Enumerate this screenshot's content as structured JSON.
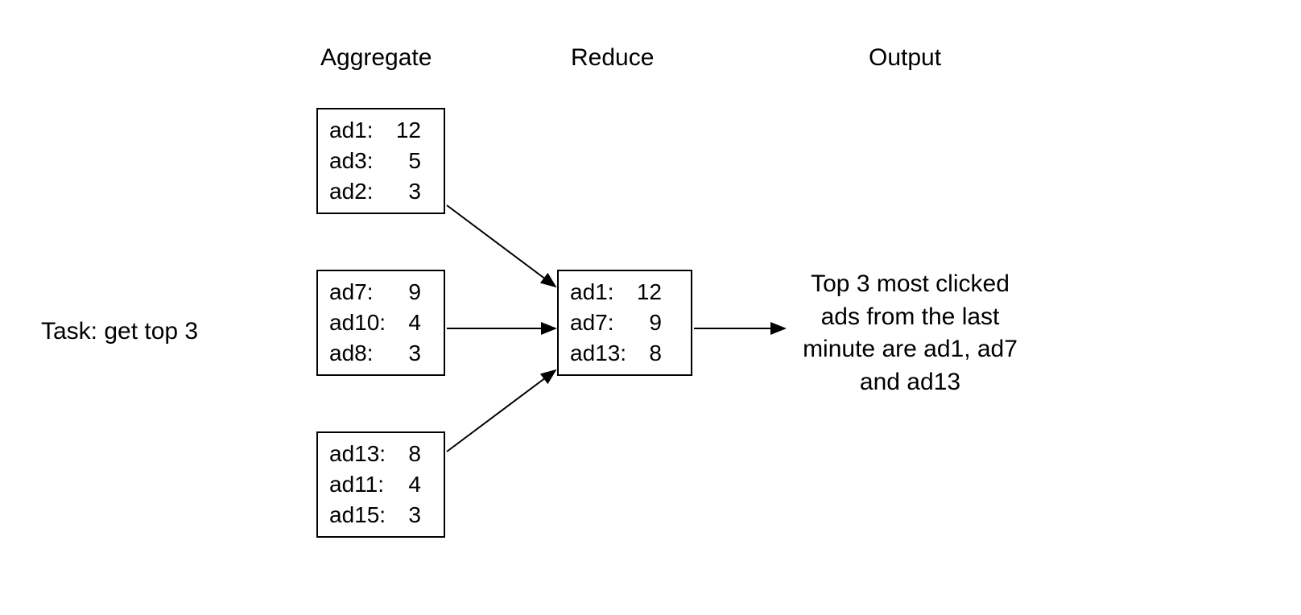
{
  "headers": {
    "aggregate": "Aggregate",
    "reduce": "Reduce",
    "output": "Output"
  },
  "task_label": "Task: get top 3",
  "aggregate_boxes": [
    {
      "rows": [
        {
          "key": "ad1:",
          "val": "12"
        },
        {
          "key": "ad3:",
          "val": "5"
        },
        {
          "key": "ad2:",
          "val": "3"
        }
      ]
    },
    {
      "rows": [
        {
          "key": "ad7:",
          "val": "9"
        },
        {
          "key": "ad10:",
          "val": "4"
        },
        {
          "key": "ad8:",
          "val": "3"
        }
      ]
    },
    {
      "rows": [
        {
          "key": "ad13:",
          "val": "8"
        },
        {
          "key": "ad11:",
          "val": "4"
        },
        {
          "key": "ad15:",
          "val": "3"
        }
      ]
    }
  ],
  "reduce_box": {
    "rows": [
      {
        "key": "ad1:",
        "val": "12"
      },
      {
        "key": "ad7:",
        "val": "9"
      },
      {
        "key": "ad13:",
        "val": "8"
      }
    ]
  },
  "output_text": "Top 3 most clicked ads from the last minute are ad1, ad7 and ad13"
}
